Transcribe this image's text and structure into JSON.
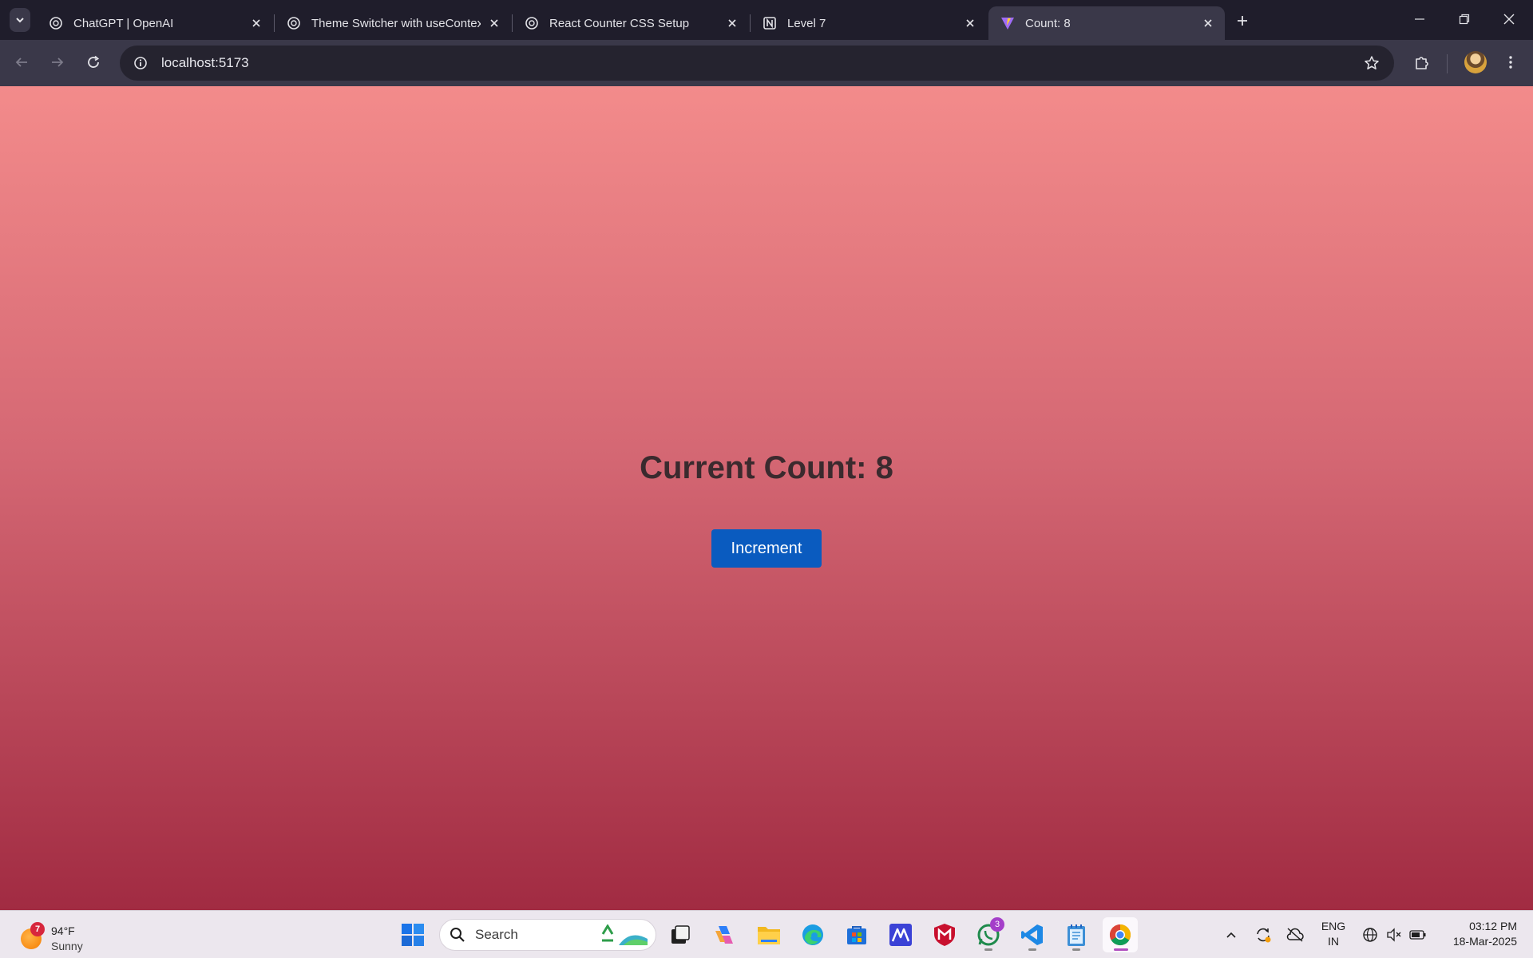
{
  "browser": {
    "tabs": [
      {
        "title": "ChatGPT | OpenAI",
        "icon": "openai-icon",
        "active": false
      },
      {
        "title": "Theme Switcher with useContext",
        "icon": "openai-icon",
        "active": false
      },
      {
        "title": "React Counter CSS Setup",
        "icon": "openai-icon",
        "active": false
      },
      {
        "title": "Level 7",
        "icon": "notion-icon",
        "active": false
      },
      {
        "title": "Count: 8",
        "icon": "vite-icon",
        "active": true
      }
    ],
    "url": "localhost:5173"
  },
  "page": {
    "heading": "Current Count: 8",
    "count": 8,
    "button_label": "Increment",
    "colors": {
      "gradient_top": "#f38b8b",
      "gradient_bottom": "#a12b42",
      "button": "#0a5bbf",
      "heading": "#3a2a2e"
    }
  },
  "taskbar": {
    "weather": {
      "badge": "7",
      "temp": "94°F",
      "condition": "Sunny"
    },
    "search_label": "Search",
    "whatsapp_badge": "3",
    "language": {
      "line1": "ENG",
      "line2": "IN"
    },
    "clock": {
      "time": "03:12 PM",
      "date": "18-Mar-2025"
    }
  }
}
